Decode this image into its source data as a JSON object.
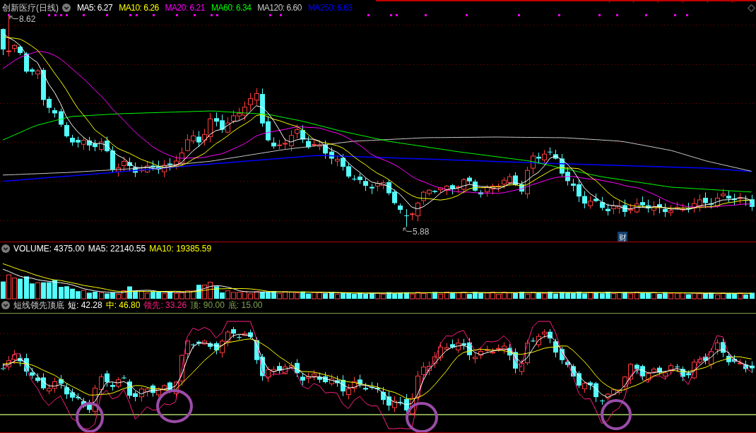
{
  "price_panel": {
    "title": "创新医疗(日线)",
    "indicators": [
      {
        "label": "MA5: 6.27",
        "color": "#ffffff"
      },
      {
        "label": "MA10: 6.26",
        "color": "#ffff00"
      },
      {
        "label": "MA20: 6.21",
        "color": "#ff00ff"
      },
      {
        "label": "MA60: 6.34",
        "color": "#00ff00"
      },
      {
        "label": "MA120: 6.60",
        "color": "#c8c8c8"
      },
      {
        "label": "MA250: 6.63",
        "color": "#0000ff"
      }
    ],
    "high_label": "8.62",
    "low_label": "5.88",
    "event_badge": "财"
  },
  "volume_panel": {
    "indicators": [
      {
        "label": "VOLUME: 4375.00",
        "color": "#ffffff"
      },
      {
        "label": "MA5: 22140.55",
        "color": "#ffffff"
      },
      {
        "label": "MA10: 19385.59",
        "color": "#ffff00"
      }
    ]
  },
  "indicator_panel": {
    "title": "短线领先顶底",
    "indicators": [
      {
        "label": "短: 42.28",
        "color": "#ffffff"
      },
      {
        "label": "中: 46.80",
        "color": "#ffff00"
      },
      {
        "label": "领先: 33.26",
        "color": "#ff2080"
      },
      {
        "label": "顶: 90.00",
        "color": "#80a050"
      },
      {
        "label": "底: 15.00",
        "color": "#80a050"
      }
    ]
  }
}
